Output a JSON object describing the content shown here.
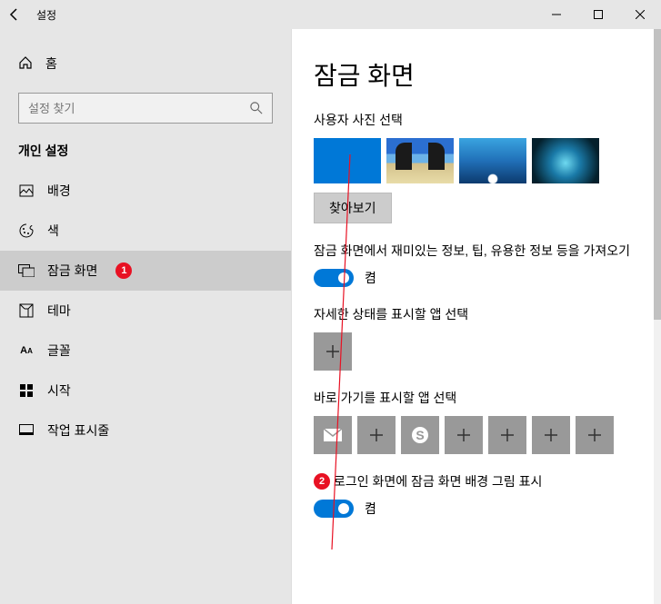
{
  "window": {
    "title": "설정"
  },
  "sidebar": {
    "home": "홈",
    "search_placeholder": "설정 찾기",
    "section": "개인 설정",
    "items": [
      {
        "label": "배경"
      },
      {
        "label": "색"
      },
      {
        "label": "잠금 화면",
        "selected": true
      },
      {
        "label": "테마"
      },
      {
        "label": "글꼴"
      },
      {
        "label": "시작"
      },
      {
        "label": "작업 표시줄"
      }
    ]
  },
  "content": {
    "heading": "잠금 화면",
    "pick_photo_label": "사용자 사진 선택",
    "browse_button": "찾아보기",
    "tips_label": "잠금 화면에서 재미있는 정보, 팁, 유용한 정보 등을 가져오기",
    "tips_toggle_state": "켬",
    "detail_app_label": "자세한 상태를 표시할 앱 선택",
    "quick_app_label": "바로 가기를 표시할 앱 선택",
    "login_bg_label": "로그인 화면에 잠금 화면 배경 그림 표시",
    "login_bg_toggle_state": "켬",
    "badge1": "1",
    "badge2": "2"
  }
}
